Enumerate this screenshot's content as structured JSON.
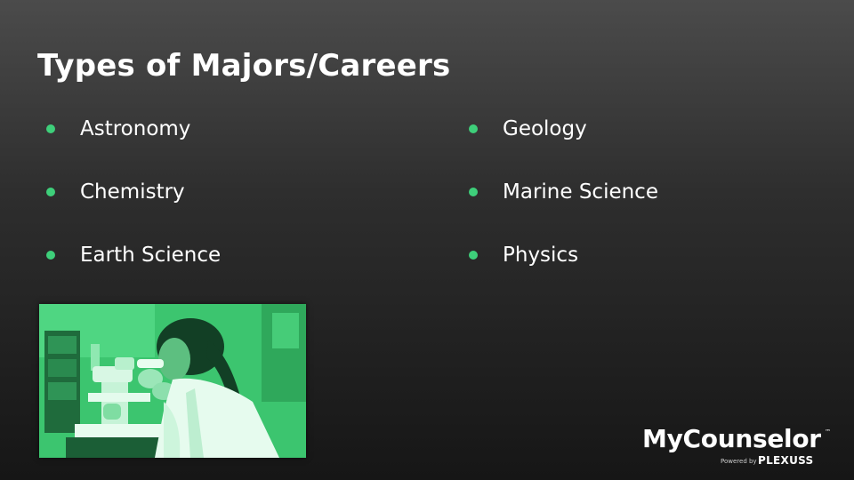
{
  "slide": {
    "title": "Types of Majors/Careers",
    "left_column": [
      {
        "label": "Astronomy"
      },
      {
        "label": "Chemistry"
      },
      {
        "label": "Earth Science"
      }
    ],
    "right_column": [
      {
        "label": "Geology"
      },
      {
        "label": "Marine Science"
      },
      {
        "label": "Physics"
      }
    ],
    "image_subject": "scientist-using-microscope-photo",
    "colors": {
      "bullet": "#3ecf7a",
      "photo_tint": "#35b866",
      "text": "#ffffff"
    }
  },
  "logo": {
    "name": "MyCounselor",
    "trademark": "™",
    "powered_by": "Powered by",
    "brand": "PLEXUSS"
  }
}
